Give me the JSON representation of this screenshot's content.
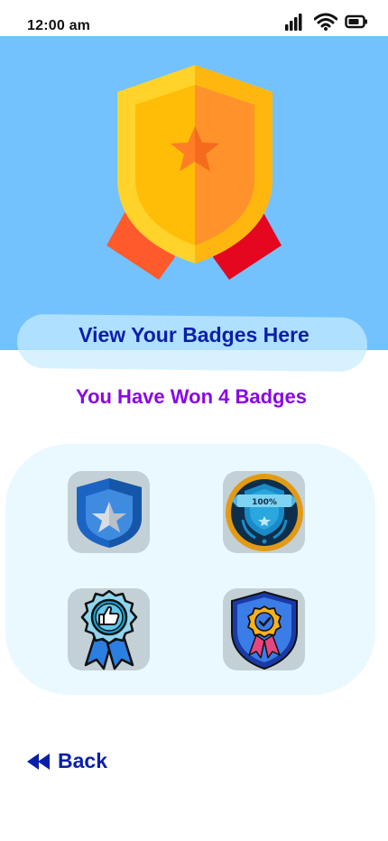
{
  "status_bar": {
    "time": "12:00 am"
  },
  "hero": {
    "icon": "shield-medal-icon",
    "background_color": "#73c2fd"
  },
  "banner": {
    "title": "View Your Badges Here"
  },
  "summary": {
    "text": "You Have Won 4 Badges"
  },
  "badges": [
    {
      "icon": "star-shield-badge-icon"
    },
    {
      "icon": "hundred-percent-badge-icon"
    },
    {
      "icon": "thumbs-up-rosette-badge-icon"
    },
    {
      "icon": "check-shield-badge-icon"
    }
  ],
  "navigation": {
    "back_label": "Back",
    "back_icon": "rewind-icon"
  },
  "colors": {
    "accent_blue": "#0a1fa8",
    "accent_purple": "#8a06e6",
    "panel": "#e9f9ff"
  }
}
